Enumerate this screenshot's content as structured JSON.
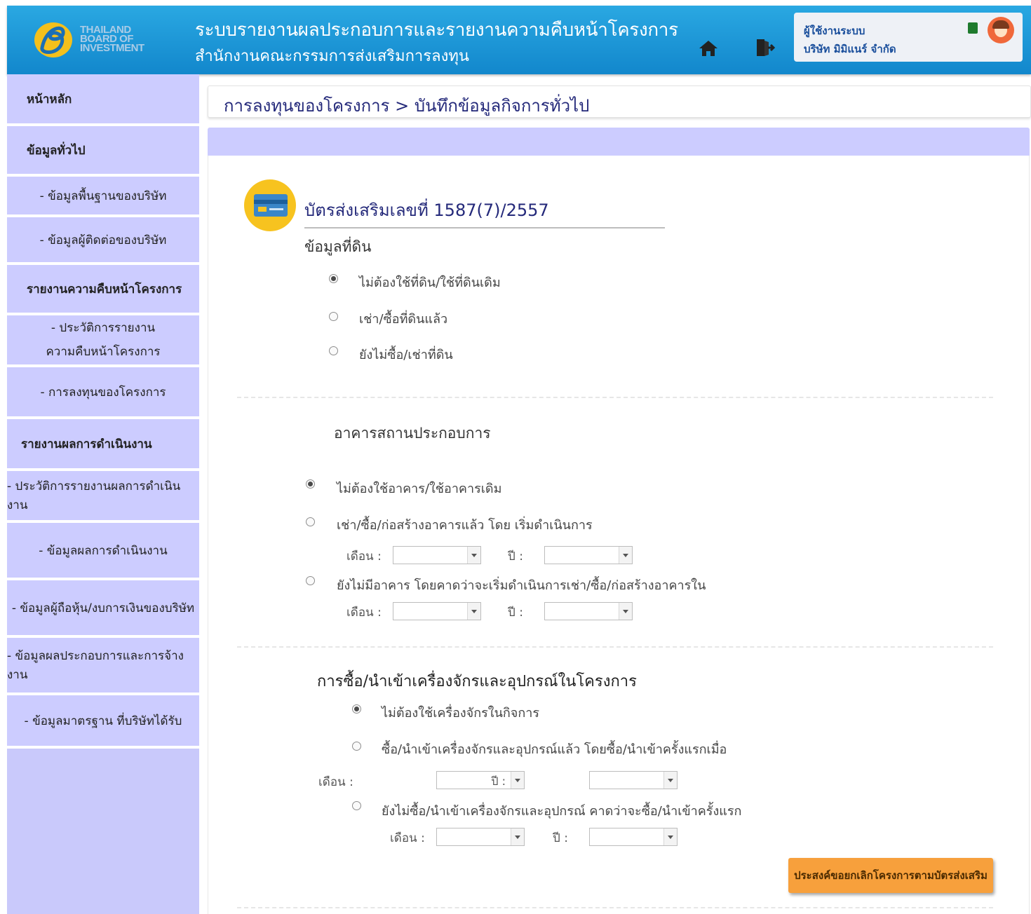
{
  "header": {
    "logo_text": [
      "THAILAND",
      "BOARD OF",
      "INVESTMENT"
    ],
    "title": "ระบบรายงานผลประกอบการและรายงานความคืบหน้าโครงการ",
    "subtitle": "สำนักงานคณะกรรมการส่งเสริมการลงทุน",
    "user_role": "ผู้ใช้งานระบบ",
    "user_company": "บริษัท มิมิแนร์ จำกัด"
  },
  "sidebar": {
    "items": [
      {
        "label": "หน้าหลัก"
      },
      {
        "label": "ข้อมูลทั่วไป"
      },
      {
        "label": "- ข้อมูลพื้นฐานของบริษัท"
      },
      {
        "label": "- ข้อมูลผู้ติดต่อของบริษัท"
      },
      {
        "label": "รายงานความคืบหน้าโครงการ"
      },
      {
        "label": "- ประวัติการรายงาน",
        "label2": "ความคืบหน้าโครงการ"
      },
      {
        "label": "- การลงทุนของโครงการ"
      },
      {
        "label": "รายงานผลการดำเนินงาน"
      },
      {
        "label": "- ประวัติการรายงานผลการดำเนินงาน"
      },
      {
        "label": "- ข้อมูลผลการดำเนินงาน"
      },
      {
        "label": "- ข้อมูลผู้ถือหุ้น/งบการเงินของบริษัท"
      },
      {
        "label": "- ข้อมูลผลประกอบการและการจ้างงาน"
      },
      {
        "label": "- ข้อมูลมาตรฐาน ที่บริษัทได้รับ"
      }
    ]
  },
  "breadcrumb": "การลงทุนของโครงการ > บันทึกข้อมูลกิจการทั่วไป",
  "certificate": {
    "title": "บัตรส่งเสริมเลขที่ 1587(7)/2557"
  },
  "land": {
    "label": "ข้อมูลที่ดิน",
    "options": [
      {
        "label": "ไม่ต้องใช้ที่ดิน/ใช้ที่ดินเดิม",
        "checked": true
      },
      {
        "label": "เช่า/ซื้อที่ดินแล้ว",
        "checked": false
      },
      {
        "label": "ยังไม่ซื้อ/เช่าที่ดิน",
        "checked": false
      }
    ]
  },
  "building": {
    "label": "อาคารสถานประกอบการ",
    "options": [
      {
        "label": "ไม่ต้องใช้อาคาร/ใช้อาคารเดิม",
        "checked": true
      },
      {
        "label": "เช่า/ซื้อ/ก่อสร้างอาคารแล้ว โดย    เริ่มดำเนินการ",
        "checked": false
      },
      {
        "label": "ยังไม่มีอาคาร โดยคาดว่าจะเริ่มดำเนินการเช่า/ซื้อ/ก่อสร้างอาคารใน",
        "checked": false
      }
    ],
    "month_label": "เดือน :",
    "year_label": "ปี :"
  },
  "machinery": {
    "label": "การซื้อ/นำเข้าเครื่องจักรและอุปกรณ์ในโครงการ",
    "options": [
      {
        "label": "ไม่ต้องใช้เครื่องจักรในกิจการ",
        "checked": true
      },
      {
        "label": "ซื้อ/นำเข้าเครื่องจักรและอุปกรณ์แล้ว โดยซื้อ/นำเข้าครั้งแรกเมื่อ",
        "checked": false
      },
      {
        "label": "ยังไม่ซื้อ/นำเข้าเครื่องจักรและอุปกรณ์ คาดว่าจะซื้อ/นำเข้าครั้งแรก",
        "checked": false
      }
    ],
    "month_label": "เดือน :",
    "year_label": "ปี :",
    "inline_year_value": "ปี :"
  },
  "cancel_button": "ประสงค์ขอยกเลิกโครงการตามบัตรส่งเสริม"
}
